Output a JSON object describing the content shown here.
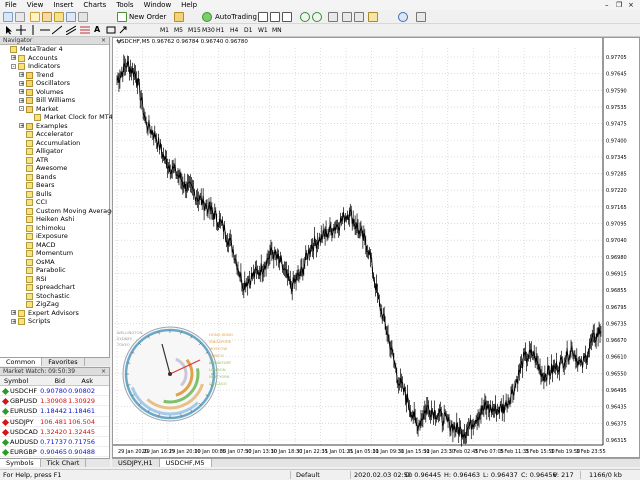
{
  "menu": [
    "File",
    "View",
    "Insert",
    "Charts",
    "Tools",
    "Window",
    "Help"
  ],
  "toolbar": {
    "new_order": "New Order",
    "autotrading": "AutoTrading"
  },
  "timeframes": [
    "M1",
    "M5",
    "M15",
    "M30",
    "H1",
    "H4",
    "D1",
    "W1",
    "MN"
  ],
  "navigator": {
    "title": "Navigator",
    "items": [
      {
        "label": "MetaTrader 4",
        "level": 0,
        "icon": "terminal-icon",
        "exp": ""
      },
      {
        "label": "Accounts",
        "level": 1,
        "icon": "accounts-icon",
        "exp": "+"
      },
      {
        "label": "Indicators",
        "level": 1,
        "icon": "indicators-icon",
        "exp": "-"
      },
      {
        "label": "Trend",
        "level": 2,
        "icon": "folder-icon",
        "exp": "+"
      },
      {
        "label": "Oscillators",
        "level": 2,
        "icon": "folder-icon",
        "exp": "+"
      },
      {
        "label": "Volumes",
        "level": 2,
        "icon": "folder-icon",
        "exp": "+"
      },
      {
        "label": "Bill Williams",
        "level": 2,
        "icon": "folder-icon",
        "exp": "+"
      },
      {
        "label": "Market",
        "level": 2,
        "icon": "folder-icon",
        "exp": "-"
      },
      {
        "label": "Market Clock for MT4",
        "level": 3,
        "icon": "indicator-icon",
        "exp": ""
      },
      {
        "label": "Examples",
        "level": 2,
        "icon": "folder-icon",
        "exp": "+"
      },
      {
        "label": "Accelerator",
        "level": 2,
        "icon": "indicator-icon",
        "exp": ""
      },
      {
        "label": "Accumulation",
        "level": 2,
        "icon": "indicator-icon",
        "exp": ""
      },
      {
        "label": "Alligator",
        "level": 2,
        "icon": "indicator-icon",
        "exp": ""
      },
      {
        "label": "ATR",
        "level": 2,
        "icon": "indicator-icon",
        "exp": ""
      },
      {
        "label": "Awesome",
        "level": 2,
        "icon": "indicator-icon",
        "exp": ""
      },
      {
        "label": "Bands",
        "level": 2,
        "icon": "indicator-icon",
        "exp": ""
      },
      {
        "label": "Bears",
        "level": 2,
        "icon": "indicator-icon",
        "exp": ""
      },
      {
        "label": "Bulls",
        "level": 2,
        "icon": "indicator-icon",
        "exp": ""
      },
      {
        "label": "CCI",
        "level": 2,
        "icon": "indicator-icon",
        "exp": ""
      },
      {
        "label": "Custom Moving Averages",
        "level": 2,
        "icon": "indicator-icon",
        "exp": ""
      },
      {
        "label": "Heiken Ashi",
        "level": 2,
        "icon": "indicator-icon",
        "exp": ""
      },
      {
        "label": "Ichimoku",
        "level": 2,
        "icon": "indicator-icon",
        "exp": ""
      },
      {
        "label": "iExposure",
        "level": 2,
        "icon": "indicator-icon",
        "exp": ""
      },
      {
        "label": "MACD",
        "level": 2,
        "icon": "indicator-icon",
        "exp": ""
      },
      {
        "label": "Momentum",
        "level": 2,
        "icon": "indicator-icon",
        "exp": ""
      },
      {
        "label": "OsMA",
        "level": 2,
        "icon": "indicator-icon",
        "exp": ""
      },
      {
        "label": "Parabolic",
        "level": 2,
        "icon": "indicator-icon",
        "exp": ""
      },
      {
        "label": "RSI",
        "level": 2,
        "icon": "indicator-icon",
        "exp": ""
      },
      {
        "label": "spreadchart",
        "level": 2,
        "icon": "indicator-icon",
        "exp": ""
      },
      {
        "label": "Stochastic",
        "level": 2,
        "icon": "indicator-icon",
        "exp": ""
      },
      {
        "label": "ZigZag",
        "level": 2,
        "icon": "indicator-icon",
        "exp": ""
      },
      {
        "label": "Expert Advisors",
        "level": 1,
        "icon": "experts-icon",
        "exp": "+"
      },
      {
        "label": "Scripts",
        "level": 1,
        "icon": "scripts-icon",
        "exp": "+"
      }
    ],
    "tabs": [
      "Common",
      "Favorites"
    ]
  },
  "market_watch": {
    "title": "Market Watch: 09:50:39",
    "col_symbol": "Symbol",
    "col_bid": "Bid",
    "col_ask": "Ask",
    "rows": [
      {
        "symbol": "USDCHF",
        "bid": "0.90780",
        "ask": "0.90802",
        "dir": "up"
      },
      {
        "symbol": "GBPUSD",
        "bid": "1.30908",
        "ask": "1.30929",
        "dir": "dn"
      },
      {
        "symbol": "EURUSD",
        "bid": "1.18442",
        "ask": "1.18461",
        "dir": "up"
      },
      {
        "symbol": "USDJPY",
        "bid": "106.481",
        "ask": "106.504",
        "dir": "dn"
      },
      {
        "symbol": "USDCAD",
        "bid": "1.32420",
        "ask": "1.32445",
        "dir": "dn"
      },
      {
        "symbol": "AUDUSD",
        "bid": "0.71737",
        "ask": "0.71756",
        "dir": "up"
      },
      {
        "symbol": "EURGBP",
        "bid": "0.90465",
        "ask": "0.90488",
        "dir": "up"
      }
    ],
    "tabs": [
      "Symbols",
      "Tick Chart"
    ]
  },
  "chart": {
    "title": "USDCHF,M5  0.96762 0.96784 0.96740 0.96780",
    "tabs": [
      "USDJPY,H1",
      "USDCHF,M5"
    ],
    "colors": {
      "candle": "#000000",
      "grid": "#c8c8c8",
      "background": "#ffffff"
    }
  },
  "chart_data": {
    "type": "line",
    "title": "",
    "x_ticks": [
      "29 Jan 2020",
      "29 Jan 16:15",
      "29 Jan 20:10",
      "30 Jan 00:05",
      "30 Jan 07:50",
      "30 Jan 13:10",
      "30 Jan 18:30",
      "30 Jan 22:35",
      "31 Jan 01:25",
      "31 Jan 05:10",
      "31 Jan 09:30",
      "31 Jan 15:50",
      "31 Jan 23:30",
      "3 Feb 02:45",
      "3 Feb 07:05",
      "3 Feb 11:35",
      "3 Feb 15:50",
      "3 Feb 19:50",
      "3 Feb 23:55"
    ],
    "y_ticks": [
      "0.97705",
      "0.97645",
      "0.97590",
      "0.97535",
      "0.97475",
      "0.97400",
      "0.97345",
      "0.97285",
      "0.97220",
      "0.97165",
      "0.97095",
      "0.97040",
      "0.96980",
      "0.96915",
      "0.96855",
      "0.96795",
      "0.96735",
      "0.96670",
      "0.96610",
      "0.96550",
      "0.96495",
      "0.96435",
      "0.96375",
      "0.96315"
    ],
    "ylim": [
      0.9626,
      0.9774
    ],
    "series": [
      {
        "values": [
          0.9762,
          0.9768,
          0.9764,
          0.9746,
          0.9741,
          0.9732,
          0.9728,
          0.9723,
          0.972,
          0.9716,
          0.9712,
          0.9707,
          0.9699,
          0.9686,
          0.9689,
          0.9692,
          0.9698,
          0.9693,
          0.9685,
          0.969,
          0.97,
          0.9703,
          0.9706,
          0.9709,
          0.9713,
          0.9706,
          0.9699,
          0.968,
          0.9667,
          0.9651,
          0.9643,
          0.9633,
          0.964,
          0.9638,
          0.9635,
          0.9632,
          0.9631,
          0.9636,
          0.964,
          0.9639,
          0.964,
          0.9647,
          0.9658,
          0.966,
          0.9652,
          0.9654,
          0.9657,
          0.9662,
          0.9655,
          0.9664,
          0.9669
        ]
      }
    ],
    "clock_labels": [
      "WELLINGTON",
      "SYDNEY",
      "TOKYO",
      "HONG KONG",
      "SINGAPORE",
      "MOSCOW",
      "ZURICH",
      "FRANKFURT",
      "LONDON",
      "NEW YORK",
      "CHICAGO"
    ]
  },
  "statusbar": {
    "help": "For Help, press F1",
    "profile": "Default",
    "datetime": "2020.02.03 02:50",
    "open": "O: 0.96445",
    "high": "H: 0.96463",
    "low": "L: 0.96437",
    "close": "C: 0.96456",
    "volume": "V: 217",
    "traffic": "1166/0 kb"
  }
}
